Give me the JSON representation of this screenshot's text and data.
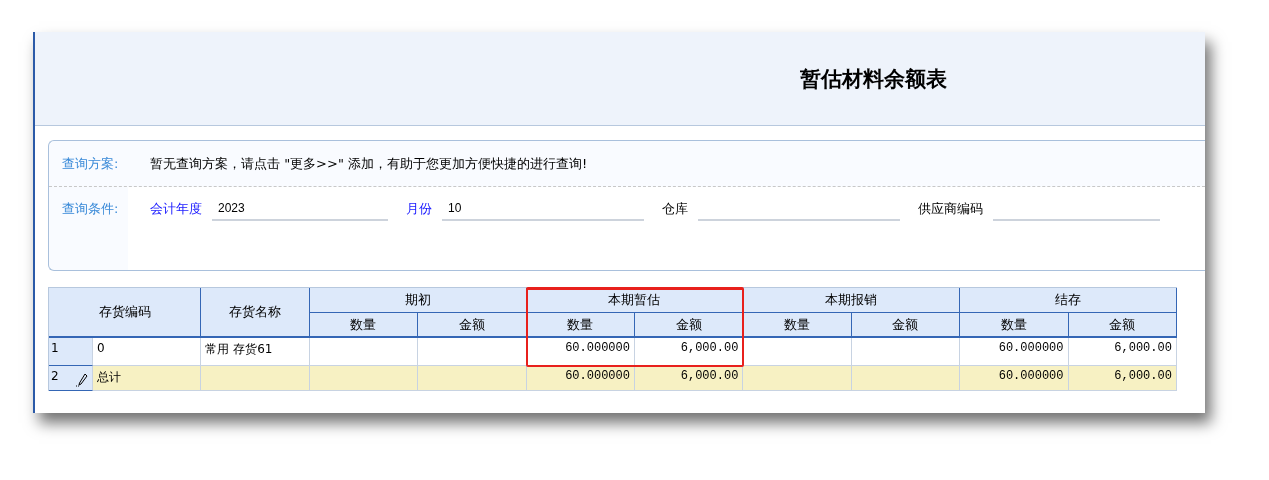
{
  "title": "暂估材料余额表",
  "query": {
    "scheme_label": "查询方案:",
    "scheme_message": "暂无查询方案，请点击 \"更多>>\" 添加，有助于您更加方便快捷的进行查询!",
    "conditions_label": "查询条件:",
    "fields": [
      {
        "label": "会计年度",
        "value": "2023",
        "required": true
      },
      {
        "label": "月份",
        "value": "10",
        "required": true
      },
      {
        "label": "仓库",
        "required": false
      },
      {
        "label": "供应商编码",
        "required": false
      }
    ]
  },
  "table": {
    "columns": [
      "存货编码",
      "存货名称"
    ],
    "groups": [
      {
        "label": "期初",
        "highlighted": false,
        "columns": [
          "数量",
          "金额"
        ]
      },
      {
        "label": "本期暂估",
        "highlighted": true,
        "columns": [
          "数量",
          "金额"
        ]
      },
      {
        "label": "本期报销",
        "highlighted": false,
        "columns": [
          "数量",
          "金额"
        ]
      },
      {
        "label": "结存",
        "highlighted": false,
        "columns": [
          "数量",
          "金额"
        ]
      }
    ],
    "rows": [
      {
        "number": "1",
        "kind": "item",
        "editing": false,
        "cells": [
          "0",
          "常用  存货61",
          "",
          "",
          "60.000000",
          "6,000.00",
          "",
          "",
          "60.000000",
          "6,000.00"
        ]
      },
      {
        "number": "2",
        "kind": "total",
        "editing": true,
        "cells": [
          "总计",
          "",
          "",
          "",
          "60.000000",
          "6,000.00",
          "",
          "",
          "60.000000",
          "6,000.00"
        ]
      }
    ]
  }
}
